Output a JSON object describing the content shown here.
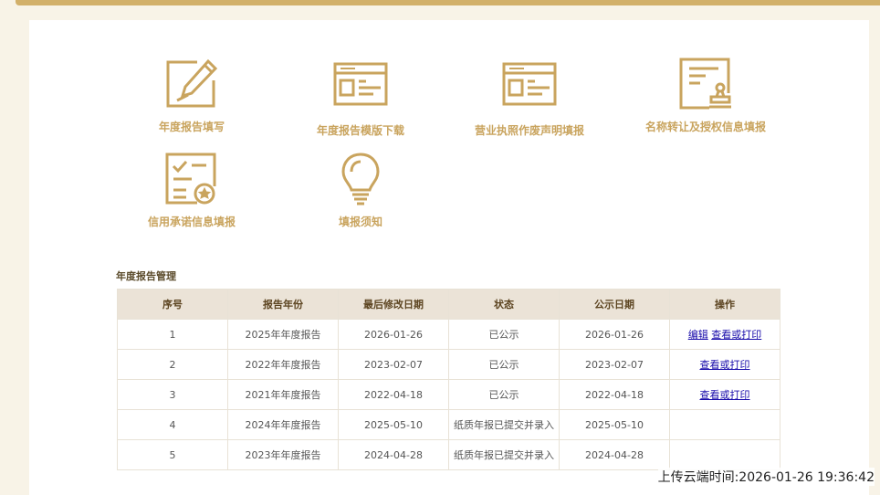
{
  "colors": {
    "accent": "#c9a45e",
    "top_bar": "#d2b06a",
    "header_bg": "#ebe3d7",
    "link": "#1a0dab"
  },
  "tiles": [
    {
      "icon": "pencil-edit-icon",
      "label": "年度报告填写"
    },
    {
      "icon": "template-download-icon",
      "label": "年度报告模版下载"
    },
    {
      "icon": "license-void-icon",
      "label": "营业执照作废声明填报"
    },
    {
      "icon": "certificate-stamp-icon",
      "label": "名称转让及授权信息填报"
    },
    {
      "icon": "checklist-commitment-icon",
      "label": "信用承诺信息填报"
    },
    {
      "icon": "lightbulb-icon",
      "label": "填报须知"
    }
  ],
  "report_table": {
    "title": "年度报告管理",
    "headers": [
      "序号",
      "报告年份",
      "最后修改日期",
      "状态",
      "公示日期",
      "操作"
    ],
    "rows": [
      {
        "no": "1",
        "year": "2025年年度报告",
        "modified": "2026-01-26",
        "status": "已公示",
        "published": "2026-01-26",
        "actions": [
          "编辑",
          "查看或打印"
        ]
      },
      {
        "no": "2",
        "year": "2022年年度报告",
        "modified": "2023-02-07",
        "status": "已公示",
        "published": "2023-02-07",
        "actions": [
          "查看或打印"
        ]
      },
      {
        "no": "3",
        "year": "2021年年度报告",
        "modified": "2022-04-18",
        "status": "已公示",
        "published": "2022-04-18",
        "actions": [
          "查看或打印"
        ]
      },
      {
        "no": "4",
        "year": "2024年年度报告",
        "modified": "2025-05-10",
        "status": "纸质年报已提交并录入",
        "published": "2025-05-10",
        "actions": []
      },
      {
        "no": "5",
        "year": "2023年年度报告",
        "modified": "2024-04-28",
        "status": "纸质年报已提交并录入",
        "published": "2024-04-28",
        "actions": []
      }
    ]
  },
  "upload_time": "上传云端时间:2026-01-26 19:36:42"
}
